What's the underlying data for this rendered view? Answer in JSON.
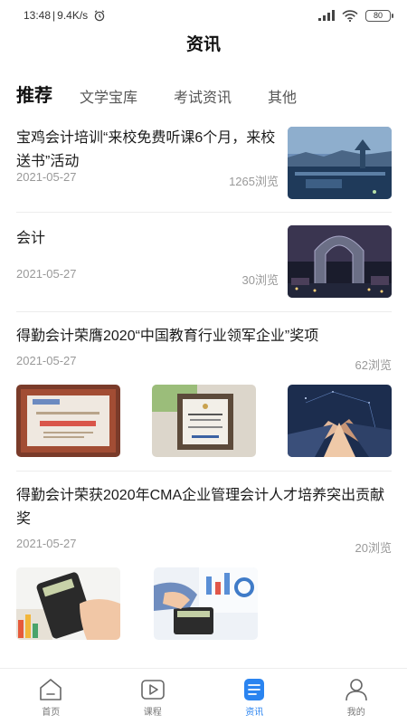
{
  "status_bar": {
    "time": "13:48",
    "speed": "9.4K/s",
    "battery": "80"
  },
  "header": {
    "title": "资讯"
  },
  "tabs": [
    {
      "label": "推荐",
      "active": true
    },
    {
      "label": "文学宝库",
      "active": false
    },
    {
      "label": "考试资讯",
      "active": false
    },
    {
      "label": "其他",
      "active": false
    }
  ],
  "feed": [
    {
      "title": "宝鸡会计培训“来校免费听课6个月，来校送书”活动",
      "date": "2021-05-27",
      "views": "1265浏览"
    },
    {
      "title": "会计",
      "date": "2021-05-27",
      "views": "30浏览"
    },
    {
      "title": "得勤会计荣膺2020“中国教育行业领军企业”奖项",
      "date": "2021-05-27",
      "views": "62浏览"
    },
    {
      "title": "得勤会计荣获2020年CMA企业管理会计人才培养突出贡献奖",
      "date": "2021-05-27",
      "views": "20浏览"
    }
  ],
  "bottom_nav": [
    {
      "label": "首页",
      "icon": "home-icon"
    },
    {
      "label": "课程",
      "icon": "course-play-icon"
    },
    {
      "label": "资讯",
      "icon": "news-document-icon",
      "active": true
    },
    {
      "label": "我的",
      "icon": "profile-icon"
    }
  ],
  "colors": {
    "accent": "#2a84f0",
    "text": "#1b1b1b",
    "muted": "#999999"
  }
}
